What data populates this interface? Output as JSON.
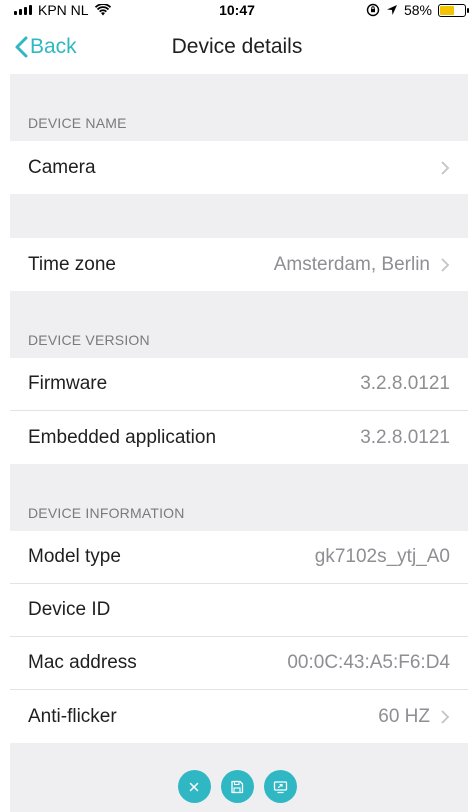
{
  "status_bar": {
    "carrier": "KPN NL",
    "time": "10:47",
    "battery_percent": "58%",
    "battery_level": 0.58
  },
  "nav": {
    "back_label": "Back",
    "title": "Device details"
  },
  "sections": {
    "device_name": {
      "header": "DEVICE NAME",
      "camera_label": "Camera"
    },
    "time_zone": {
      "label": "Time zone",
      "value": "Amsterdam, Berlin"
    },
    "device_version": {
      "header": "DEVICE VERSION",
      "firmware_label": "Firmware",
      "firmware_value": "3.2.8.0121",
      "embedded_label": "Embedded application",
      "embedded_value": "3.2.8.0121"
    },
    "device_information": {
      "header": "DEVICE INFORMATION",
      "model_label": "Model type",
      "model_value": "gk7102s_ytj_A0",
      "device_id_label": "Device ID",
      "device_id_value": "",
      "mac_label": "Mac address",
      "mac_value": "00:0C:43:A5:F6:D4",
      "antiflicker_label": "Anti-flicker",
      "antiflicker_value": "60 HZ"
    }
  },
  "colors": {
    "accent": "#2fb8c4",
    "group_background": "#efeff2",
    "secondary_text": "#8e8e93"
  },
  "icons": {
    "toolbar": [
      "close-icon",
      "save-icon",
      "screen-cast-icon"
    ]
  }
}
